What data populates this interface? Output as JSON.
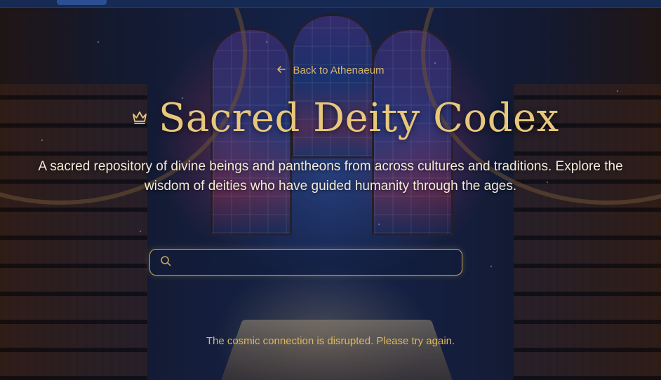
{
  "nav": {
    "back_label": "Back to Athenaeum",
    "back_icon": "arrow-left-icon"
  },
  "header": {
    "title": "Sacred Deity Codex",
    "title_icon": "crown-icon",
    "description": "A sacred repository of divine beings and pantheons from across cultures and traditions. Explore the wisdom of deities who have guided humanity through the ages."
  },
  "search": {
    "icon": "search-icon",
    "value": "",
    "placeholder": ""
  },
  "status": {
    "error_message": "The cosmic connection is disrupted. Please try again."
  },
  "colors": {
    "accent_gold": "#e7c77d",
    "text_light": "#f3ebd6",
    "topbar": "#172a54",
    "active_tab": "#2c4f93"
  }
}
